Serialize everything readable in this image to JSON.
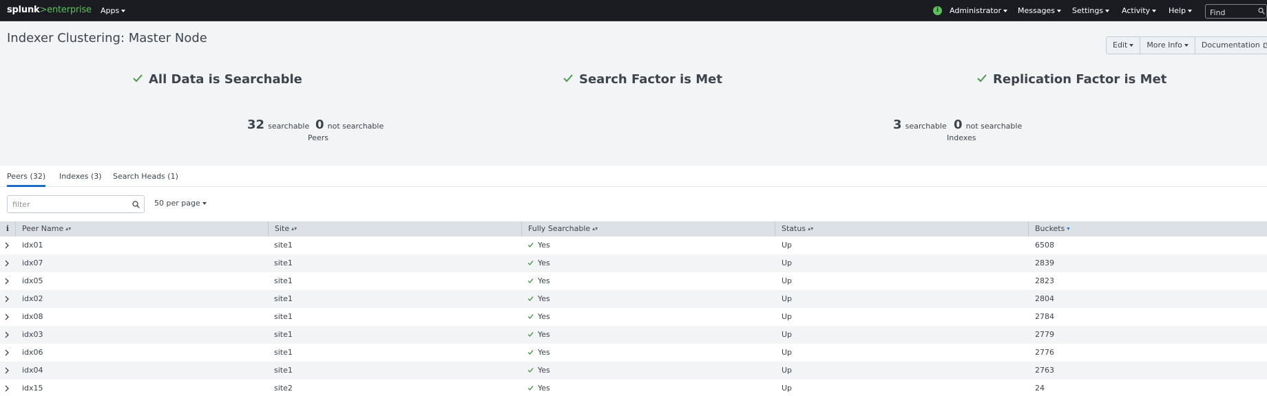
{
  "nav": {
    "logo_main": "splunk",
    "logo_sep": ">",
    "logo_product": "enterprise",
    "apps_label": "Apps",
    "status_icon_letter": "i",
    "items": [
      "Administrator",
      "Messages",
      "Settings",
      "Activity",
      "Help"
    ],
    "find_placeholder": "Find"
  },
  "header": {
    "title": "Indexer Clustering: Master Node",
    "buttons": [
      "Edit",
      "More Info",
      "Documentation"
    ]
  },
  "status": {
    "items": [
      "All Data is Searchable",
      "Search Factor is Met",
      "Replication Factor is Met"
    ],
    "peers": {
      "searchable_count": "32",
      "searchable_label": "searchable",
      "not_searchable_count": "0",
      "not_searchable_label": "not searchable",
      "caption": "Peers"
    },
    "indexes": {
      "searchable_count": "3",
      "searchable_label": "searchable",
      "not_searchable_count": "0",
      "not_searchable_label": "not searchable",
      "caption": "Indexes"
    }
  },
  "tabs": [
    "Peers (32)",
    "Indexes (3)",
    "Search Heads (1)"
  ],
  "filter": {
    "placeholder": "filter",
    "per_page": "50 per page"
  },
  "table": {
    "info_header": "i",
    "columns": [
      "Peer Name",
      "Site",
      "Fully Searchable",
      "Status",
      "Buckets"
    ],
    "rows": [
      {
        "peer": "idx01",
        "site": "site1",
        "searchable": "Yes",
        "status": "Up",
        "buckets": "6508"
      },
      {
        "peer": "idx07",
        "site": "site1",
        "searchable": "Yes",
        "status": "Up",
        "buckets": "2839"
      },
      {
        "peer": "idx05",
        "site": "site1",
        "searchable": "Yes",
        "status": "Up",
        "buckets": "2823"
      },
      {
        "peer": "idx02",
        "site": "site1",
        "searchable": "Yes",
        "status": "Up",
        "buckets": "2804"
      },
      {
        "peer": "idx08",
        "site": "site1",
        "searchable": "Yes",
        "status": "Up",
        "buckets": "2784"
      },
      {
        "peer": "idx03",
        "site": "site1",
        "searchable": "Yes",
        "status": "Up",
        "buckets": "2779"
      },
      {
        "peer": "idx06",
        "site": "site1",
        "searchable": "Yes",
        "status": "Up",
        "buckets": "2776"
      },
      {
        "peer": "idx04",
        "site": "site1",
        "searchable": "Yes",
        "status": "Up",
        "buckets": "2763"
      },
      {
        "peer": "idx15",
        "site": "site2",
        "searchable": "Yes",
        "status": "Up",
        "buckets": "24"
      }
    ]
  },
  "colors": {
    "topbar": "#1a1c21",
    "accent_green": "#5cc05c",
    "check_green": "#4a9a4a",
    "tab_underline": "#1a6cc8",
    "header_bg": "#f2f4f5"
  }
}
